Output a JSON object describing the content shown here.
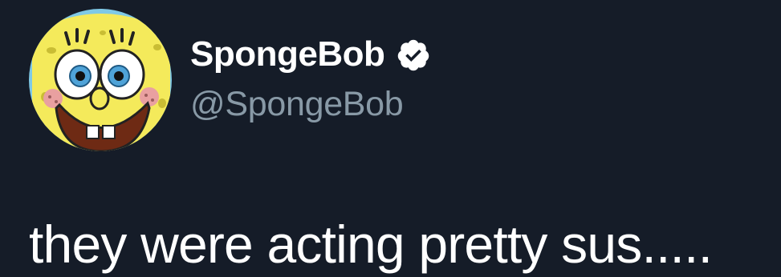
{
  "tweet": {
    "author": {
      "display_name": "SpongeBob",
      "handle": "@SpongeBob",
      "verified": true,
      "avatar_icon": "spongebob-avatar"
    },
    "text": "they were acting pretty sus....."
  },
  "colors": {
    "background": "#151c28",
    "name": "#ffffff",
    "handle": "#8899a6",
    "text": "#ffffff",
    "verified_badge": "#ffffff"
  }
}
